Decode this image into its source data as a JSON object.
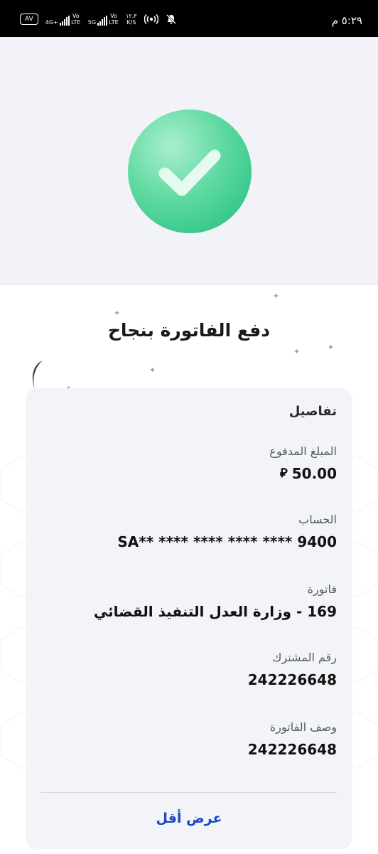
{
  "status_bar": {
    "av_badge": "AV",
    "sim1_network": "4G+",
    "sim1_volte": "Vo LTE",
    "sim2_network": "5G",
    "sim2_volte": "Vo LTE",
    "speed_value": "١٢،٣",
    "speed_unit": "K/S",
    "time": "٥:٢٩ م"
  },
  "success": {
    "title": "دفع الفاتورة بنجاح"
  },
  "details": {
    "heading": "تفاصيل",
    "amount_label": "المبلغ المدفوع",
    "amount_value": "50.00",
    "account_label": "الحساب",
    "account_value": "SA** **** **** **** **** 9400",
    "bill_label": "فاتورة",
    "bill_value": "169 - وزارة العدل التنفيذ القضائي",
    "subscriber_label": "رقم المشترك",
    "subscriber_value": "242226648",
    "bill_desc_label": "وصف الفاتورة",
    "bill_desc_value": "242226648",
    "show_less": "عرض أقل"
  },
  "icons": {
    "success": "check-circle-icon",
    "currency": "saudi-riyal-icon",
    "hotspot": "hotspot-icon",
    "mute": "bell-off-icon"
  },
  "colors": {
    "success_green": "#1cbd7d",
    "link_blue": "#1b46c7",
    "card_bg": "#f3f4f8",
    "header_bg": "#f2f3f8"
  }
}
